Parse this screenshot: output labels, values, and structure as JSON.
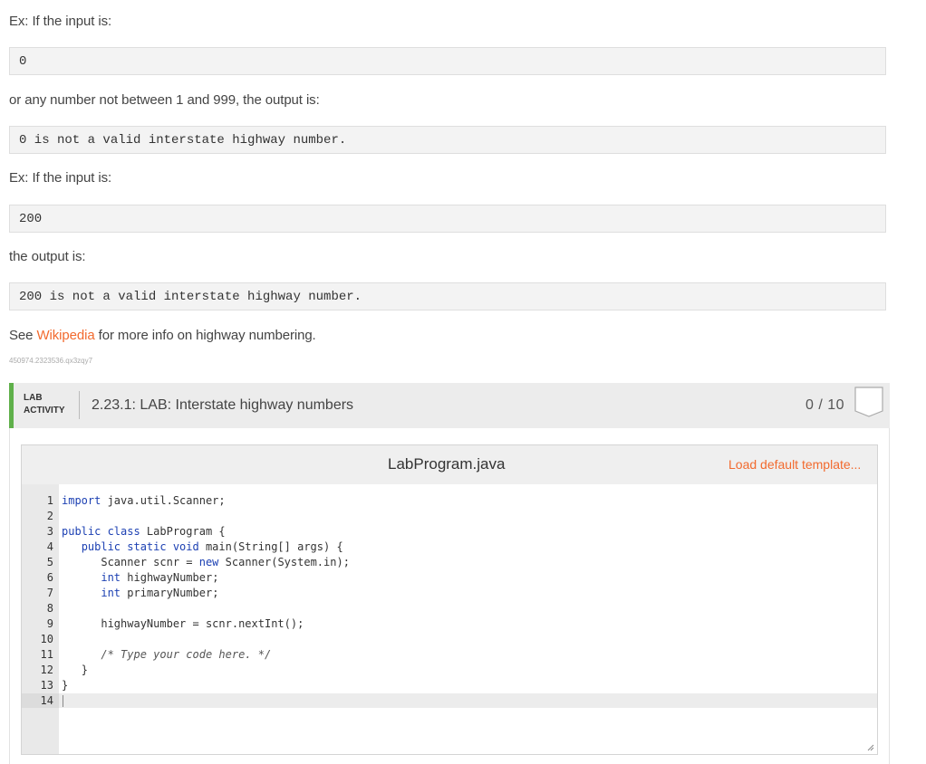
{
  "examples": {
    "ex1_intro": "Ex: If the input is:",
    "ex1_input": "0",
    "ex1_output_intro": "or any number not between 1 and 999, the output is:",
    "ex1_output": "0 is not a valid interstate highway number.",
    "ex2_intro": "Ex: If the input is:",
    "ex2_input": "200",
    "ex2_output_intro": "the output is:",
    "ex2_output": "200 is not a valid interstate highway number."
  },
  "see_also": {
    "prefix": "See ",
    "link": "Wikipedia",
    "suffix": " for more info on highway numbering."
  },
  "content_id": "450974.2323536.qx3zqy7",
  "lab": {
    "tag_line1": "LAB",
    "tag_line2": "ACTIVITY",
    "title": "2.23.1: LAB: Interstate highway numbers",
    "score": "0 / 10",
    "accent_color": "#5fb04a"
  },
  "editor": {
    "filename": "LabProgram.java",
    "load_template": "Load default template...",
    "line_numbers": [
      "1",
      "2",
      "3",
      "4",
      "5",
      "6",
      "7",
      "8",
      "9",
      "10",
      "11",
      "12",
      "13",
      "14"
    ],
    "lines": [
      {
        "kw": "import",
        "rest": " java.util.Scanner;",
        "indent": ""
      },
      {
        "kw": "",
        "rest": "",
        "indent": ""
      },
      {
        "kw": "public class",
        "rest": " LabProgram {",
        "indent": ""
      },
      {
        "kw": "public static void",
        "rest": " main(String[] args) {",
        "indent": "   "
      },
      {
        "kw": "",
        "rest": "Scanner scnr = new Scanner(System.in);",
        "indent": "      "
      },
      {
        "kw": "int",
        "rest": " highwayNumber;",
        "indent": "      "
      },
      {
        "kw": "int",
        "rest": " primaryNumber;",
        "indent": "      "
      },
      {
        "kw": "",
        "rest": "",
        "indent": ""
      },
      {
        "kw": "",
        "rest": "highwayNumber = scnr.nextInt();",
        "indent": "      "
      },
      {
        "kw": "",
        "rest": "",
        "indent": ""
      },
      {
        "kw": "",
        "rest": "",
        "indent": "      ",
        "comment": "/* Type your code here. */"
      },
      {
        "kw": "",
        "rest": "}",
        "indent": "   "
      },
      {
        "kw": "",
        "rest": "}",
        "indent": ""
      },
      {
        "kw": "",
        "rest": "",
        "indent": ""
      }
    ]
  }
}
